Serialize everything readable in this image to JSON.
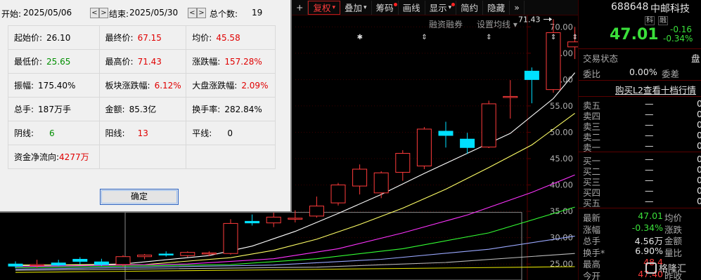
{
  "toolbar": {
    "items": [
      {
        "label": "+",
        "key": "plus"
      },
      {
        "label": "复权",
        "key": "fuquan",
        "dropdown": true,
        "active": true
      },
      {
        "label": "叠加",
        "key": "diejia",
        "dropdown": true
      },
      {
        "label": "筹码",
        "key": "chouma",
        "dot": true
      },
      {
        "label": "画线",
        "key": "huaxian"
      },
      {
        "label": "显示",
        "key": "xianshi",
        "dropdown": true,
        "dot": true
      },
      {
        "label": "简约",
        "key": "jianyue"
      },
      {
        "label": "隐藏",
        "key": "yincang"
      },
      {
        "label": "»",
        "key": "more"
      }
    ],
    "sub_items": [
      "融资融券",
      "设置均线"
    ]
  },
  "dialog": {
    "start_label": "开始:",
    "start_date": "2025/05/06",
    "end_label": "结束:",
    "end_date": "2025/05/30",
    "count_label": "总个数:",
    "count_value": "19",
    "prev_icon": "<",
    "next_icon": ">",
    "rows": [
      [
        {
          "label": "起始价:",
          "value": "26.10",
          "color": "black"
        },
        {
          "label": "最终价:",
          "value": "67.15",
          "color": "red"
        },
        {
          "label": "均价:",
          "value": "45.58",
          "color": "red"
        }
      ],
      [
        {
          "label": "最低价:",
          "value": "25.65",
          "color": "green"
        },
        {
          "label": "最高价:",
          "value": "71.43",
          "color": "red"
        },
        {
          "label": "涨跌幅:",
          "value": "157.28%",
          "color": "red"
        }
      ],
      [
        {
          "label": "振幅:",
          "value": "175.40%",
          "color": "black"
        },
        {
          "label": "板块涨跌幅:",
          "value": "6.12%",
          "color": "red"
        },
        {
          "label": "大盘涨跌幅:",
          "value": "2.09%",
          "color": "red"
        }
      ],
      [
        {
          "label": "总手:",
          "value": "187万手",
          "color": "black"
        },
        {
          "label": "金额:",
          "value": "85.3亿",
          "color": "black"
        },
        {
          "label": "换手率:",
          "value": "282.84%",
          "color": "black"
        }
      ],
      [
        {
          "label": "阴线:",
          "value": "6",
          "color": "green"
        },
        {
          "label": "阳线:",
          "value": "13",
          "color": "red"
        },
        {
          "label": "平线:",
          "value": "0",
          "color": "black"
        }
      ],
      [
        {
          "label": "资金净流向:",
          "value": "4277万",
          "color": "red"
        },
        {
          "label": "",
          "value": "",
          "color": "black"
        },
        {
          "label": "",
          "value": "",
          "color": "black"
        }
      ]
    ],
    "ok_label": "确定"
  },
  "chart": {
    "y_ticks": [
      "70.00",
      "65.00",
      "60.00",
      "55.00",
      "50.00",
      "45.00",
      "40.00",
      "35.00",
      "30.00",
      "25.00"
    ],
    "high_marker": "71.43",
    "colors": {
      "up": "#ff3b3b",
      "down": "#00e0ff",
      "ma5": "#ffffff",
      "ma10": "#ffff66",
      "ma20": "#ff33ff",
      "ma30": "#33ff33",
      "ma60": "#9aa8ff",
      "ma120": "#bbbbbb",
      "ma250": "#dddd00"
    }
  },
  "chart_data": {
    "type": "candlestick",
    "ylim": [
      22.5,
      73.5
    ],
    "y_ticks": [
      70,
      65,
      60,
      55,
      50,
      45,
      40,
      35,
      30,
      25
    ],
    "candles": [
      {
        "o": 25.0,
        "h": 25.5,
        "l": 24.2,
        "c": 24.6
      },
      {
        "o": 24.8,
        "h": 25.8,
        "l": 24.3,
        "c": 24.9
      },
      {
        "o": 25.2,
        "h": 25.8,
        "l": 24.6,
        "c": 24.8
      },
      {
        "o": 25.9,
        "h": 26.3,
        "l": 24.9,
        "c": 25.5
      },
      {
        "o": 25.4,
        "h": 26.0,
        "l": 24.6,
        "c": 24.9
      },
      {
        "o": 24.9,
        "h": 26.7,
        "l": 24.5,
        "c": 26.4
      },
      {
        "o": 26.4,
        "h": 26.9,
        "l": 25.9,
        "c": 26.7
      },
      {
        "o": 26.9,
        "h": 27.4,
        "l": 26.4,
        "c": 26.8
      },
      {
        "o": 26.6,
        "h": 27.4,
        "l": 26.3,
        "c": 27.2
      },
      {
        "o": 26.9,
        "h": 27.4,
        "l": 26.5,
        "c": 27.1
      },
      {
        "o": 27.0,
        "h": 33.5,
        "l": 26.8,
        "c": 32.7
      },
      {
        "o": 33.1,
        "h": 34.4,
        "l": 32.3,
        "c": 32.8
      },
      {
        "o": 32.8,
        "h": 35.1,
        "l": 32.0,
        "c": 33.9
      },
      {
        "o": 33.6,
        "h": 35.2,
        "l": 32.9,
        "c": 33.7
      },
      {
        "o": 34.1,
        "h": 37.8,
        "l": 33.8,
        "c": 36.0
      },
      {
        "o": 36.6,
        "h": 40.4,
        "l": 36.1,
        "c": 40.0
      },
      {
        "o": 39.8,
        "h": 43.9,
        "l": 38.2,
        "c": 43.0
      },
      {
        "o": 38.5,
        "h": 42.6,
        "l": 37.5,
        "c": 42.3
      },
      {
        "o": 42.4,
        "h": 46.6,
        "l": 40.8,
        "c": 46.0
      },
      {
        "o": 43.6,
        "h": 51.0,
        "l": 43.0,
        "c": 50.6
      },
      {
        "o": 50.2,
        "h": 52.0,
        "l": 47.1,
        "c": 49.4
      },
      {
        "o": 48.7,
        "h": 49.9,
        "l": 45.9,
        "c": 47.1
      },
      {
        "o": 47.2,
        "h": 56.0,
        "l": 47.0,
        "c": 55.4
      },
      {
        "o": 56.7,
        "h": 59.9,
        "l": 52.6,
        "c": 56.8
      },
      {
        "o": 61.6,
        "h": 62.3,
        "l": 55.5,
        "c": 60.0
      },
      {
        "o": 58.1,
        "h": 71.43,
        "l": 57.5,
        "c": 68.9
      },
      {
        "o": 66.2,
        "h": 70.0,
        "l": 63.9,
        "c": 67.15
      }
    ],
    "moving_averages": [
      {
        "name": "ma5",
        "points": [
          [
            0,
            24.7
          ],
          [
            5,
            25.0
          ],
          [
            9,
            26.6
          ],
          [
            11,
            28.4
          ],
          [
            13,
            31.2
          ],
          [
            15,
            34.6
          ],
          [
            17,
            38.2
          ],
          [
            19,
            42.2
          ],
          [
            21,
            46.0
          ],
          [
            23,
            49.8
          ],
          [
            25,
            56.4
          ],
          [
            26,
            61.3
          ]
        ]
      },
      {
        "name": "ma10",
        "points": [
          [
            0,
            24.8
          ],
          [
            6,
            24.9
          ],
          [
            10,
            26.2
          ],
          [
            12,
            27.6
          ],
          [
            14,
            29.7
          ],
          [
            16,
            32.5
          ],
          [
            18,
            35.6
          ],
          [
            20,
            39.2
          ],
          [
            22,
            43.3
          ],
          [
            24,
            47.6
          ],
          [
            26,
            53.6
          ]
        ]
      },
      {
        "name": "ma20",
        "points": [
          [
            0,
            24.5
          ],
          [
            8,
            25.0
          ],
          [
            12,
            26.0
          ],
          [
            15,
            27.9
          ],
          [
            18,
            30.9
          ],
          [
            21,
            34.3
          ],
          [
            24,
            38.6
          ],
          [
            26,
            41.9
          ]
        ]
      },
      {
        "name": "ma30",
        "points": [
          [
            0,
            24.3
          ],
          [
            10,
            24.9
          ],
          [
            14,
            26.0
          ],
          [
            18,
            27.9
          ],
          [
            22,
            30.9
          ],
          [
            26,
            35.8
          ]
        ]
      },
      {
        "name": "ma60",
        "points": [
          [
            0,
            24.0
          ],
          [
            12,
            24.8
          ],
          [
            17,
            25.9
          ],
          [
            22,
            27.8
          ],
          [
            26,
            30.3
          ]
        ]
      },
      {
        "name": "ma120",
        "points": [
          [
            0,
            23.8
          ],
          [
            14,
            24.4
          ],
          [
            20,
            25.3
          ],
          [
            26,
            27.0
          ]
        ]
      },
      {
        "name": "ma250",
        "points": [
          [
            0,
            23.4
          ],
          [
            26,
            24.5
          ]
        ]
      }
    ]
  },
  "quote": {
    "code": "688648",
    "name": "中邮科技",
    "tags": [
      "科",
      "融"
    ],
    "price": "47.01",
    "change": "-0.16",
    "change_pct": "-0.34%",
    "trade_status_label": "交易状态",
    "trade_status_value": "盘",
    "weibi_label": "委比",
    "weibi_value": "0.00%",
    "weicha_label": "委差",
    "l2_link": "购买L2查看十档行情",
    "sell": [
      "卖五",
      "卖四",
      "卖三",
      "卖二",
      "卖一"
    ],
    "buy": [
      "买一",
      "买二",
      "买三",
      "买四",
      "买五"
    ],
    "dash": "—",
    "zero": "0",
    "stats": [
      {
        "label": "最新",
        "value": "47.01",
        "label2": "均价",
        "color": "green"
      },
      {
        "label": "涨幅",
        "value": "-0.34%",
        "label2": "涨跌",
        "color": "green"
      },
      {
        "label": "总手",
        "value": "4.56万",
        "label2": "金额",
        "color": "white"
      },
      {
        "label": "换手*",
        "value": "6.90%",
        "label2": "量比",
        "color": "white"
      },
      {
        "label": "最高",
        "value": "48.4",
        "label2": "",
        "color": "red"
      },
      {
        "label": "今开",
        "value": "47.40",
        "label2": "昨收",
        "color": "red"
      }
    ],
    "watermark": "格隆汇"
  }
}
